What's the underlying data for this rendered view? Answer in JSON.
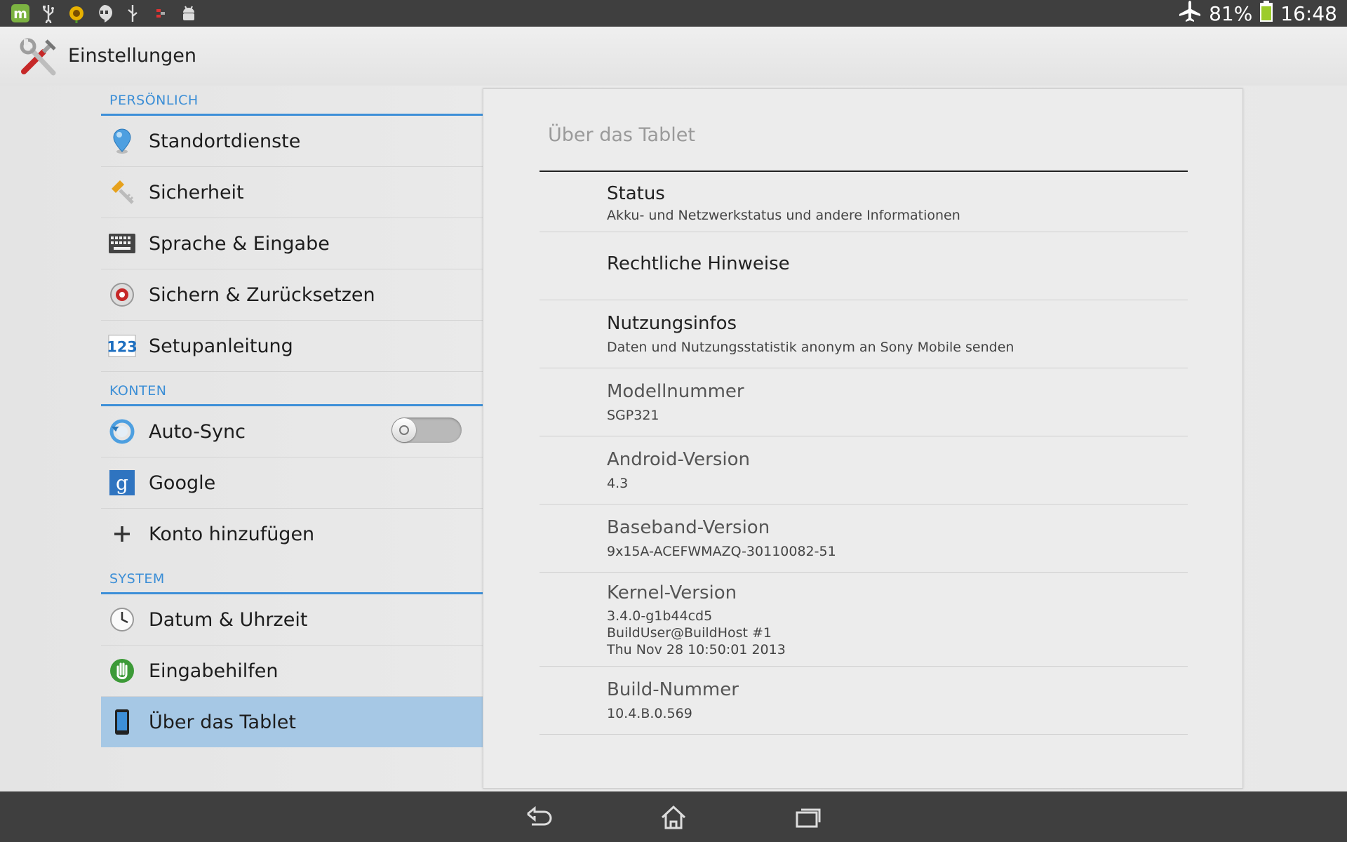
{
  "status_bar": {
    "icons_left": [
      "app-m-icon",
      "usb-icon",
      "sunflower-icon",
      "hangouts-icon",
      "usb-debug-icon",
      "signal-flag-icon",
      "android-icon"
    ],
    "icons_right": [
      "airplane-icon",
      "battery-icon"
    ],
    "battery_percent": "81%",
    "time": "16:48"
  },
  "action_bar": {
    "title": "Einstellungen",
    "icon": "settings-tools-icon"
  },
  "menu": {
    "sections": [
      {
        "header": "PERSÖNLICH",
        "items": [
          {
            "label": "Standortdienste",
            "icon": "location-icon"
          },
          {
            "label": "Sicherheit",
            "icon": "security-key-icon"
          },
          {
            "label": "Sprache & Eingabe",
            "icon": "keyboard-icon"
          },
          {
            "label": "Sichern & Zurücksetzen",
            "icon": "backup-icon"
          },
          {
            "label": "Setupanleitung",
            "icon": "setup-123-icon"
          }
        ]
      },
      {
        "header": "KONTEN",
        "items": [
          {
            "label": "Auto-Sync",
            "icon": "sync-icon",
            "toggle": false
          },
          {
            "label": "Google",
            "icon": "google-icon"
          },
          {
            "label": "Konto hinzufügen",
            "icon": "plus-icon"
          }
        ]
      },
      {
        "header": "SYSTEM",
        "items": [
          {
            "label": "Datum & Uhrzeit",
            "icon": "clock-icon"
          },
          {
            "label": "Eingabehilfen",
            "icon": "accessibility-hand-icon"
          },
          {
            "label": "Über das Tablet",
            "icon": "tablet-icon",
            "selected": true
          }
        ]
      }
    ]
  },
  "detail": {
    "title": "Über das Tablet",
    "rows": [
      {
        "title": "Status",
        "subtitle": "Akku- und Netzwerkstatus und andere Informationen"
      },
      {
        "title": "Rechtliche Hinweise",
        "subtitle": ""
      },
      {
        "title": "Nutzungsinfos",
        "subtitle": "Daten und Nutzungsstatistik anonym an Sony Mobile senden"
      },
      {
        "title": "Modellnummer",
        "subtitle": "SGP321"
      },
      {
        "title": "Android-Version",
        "subtitle": "4.3"
      },
      {
        "title": "Baseband-Version",
        "subtitle": "9x15A-ACEFWMAZQ-30110082-51"
      },
      {
        "title": "Kernel-Version",
        "subtitle": "3.4.0-g1b44cd5\nBuildUser@BuildHost #1\nThu Nov 28 10:50:01 2013"
      },
      {
        "title": "Build-Nummer",
        "subtitle": "10.4.B.0.569"
      }
    ]
  },
  "nav_bar": {
    "buttons": [
      "back-icon",
      "home-icon",
      "recent-apps-icon"
    ]
  },
  "colors": {
    "accent": "#3b8ed6",
    "selected": "#a6c8e5",
    "bars": "#3f3f3f"
  }
}
